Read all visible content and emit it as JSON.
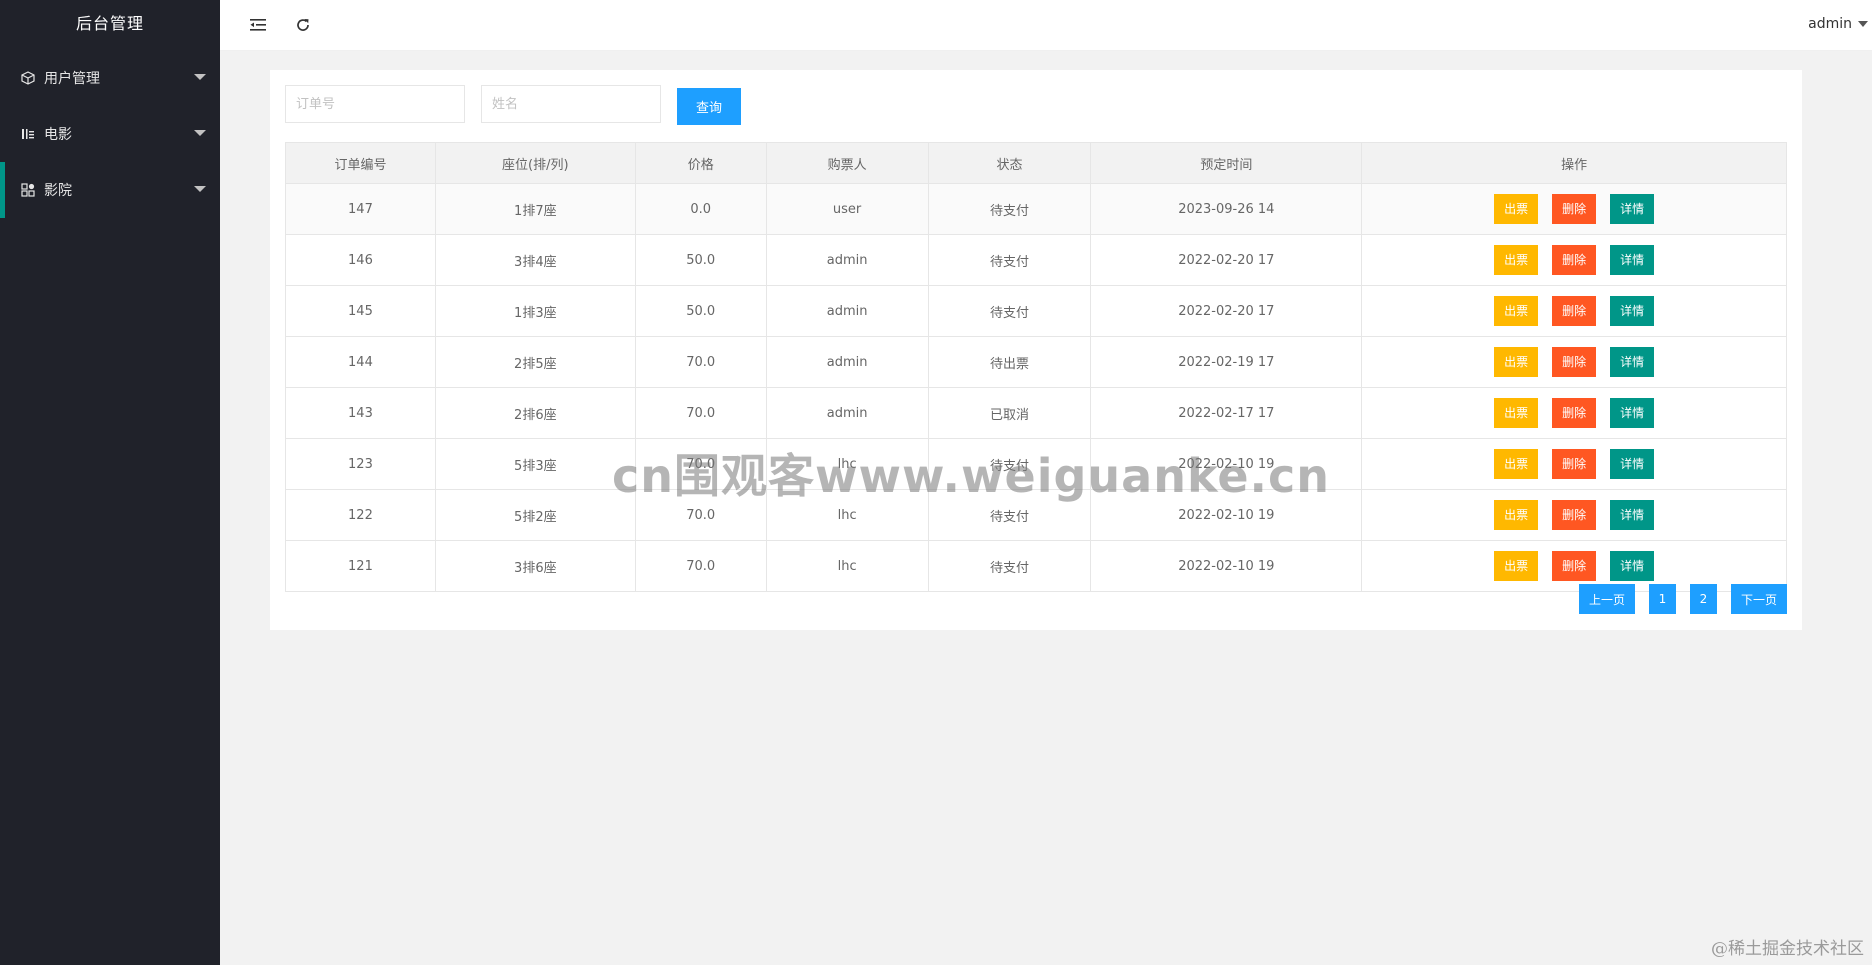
{
  "sidebar": {
    "title": "后台管理",
    "items": [
      {
        "label": "用户管理",
        "icon": "cube-icon"
      },
      {
        "label": "电影",
        "icon": "film-icon"
      },
      {
        "label": "影院",
        "icon": "apps-icon"
      }
    ],
    "accent": "#009688"
  },
  "header": {
    "user": "admin"
  },
  "search": {
    "order_placeholder": "订单号",
    "name_placeholder": "姓名",
    "query_label": "查询"
  },
  "table": {
    "columns": [
      "订单编号",
      "座位(排/列)",
      "价格",
      "购票人",
      "状态",
      "预定时间",
      "操作"
    ],
    "rows": [
      {
        "id": "147",
        "seat": "1排7座",
        "price": "0.0",
        "buyer": "user",
        "status": "待支付",
        "time": "2023-09-26 14"
      },
      {
        "id": "146",
        "seat": "3排4座",
        "price": "50.0",
        "buyer": "admin",
        "status": "待支付",
        "time": "2022-02-20 17"
      },
      {
        "id": "145",
        "seat": "1排3座",
        "price": "50.0",
        "buyer": "admin",
        "status": "待支付",
        "time": "2022-02-20 17"
      },
      {
        "id": "144",
        "seat": "2排5座",
        "price": "70.0",
        "buyer": "admin",
        "status": "待出票",
        "time": "2022-02-19 17"
      },
      {
        "id": "143",
        "seat": "2排6座",
        "price": "70.0",
        "buyer": "admin",
        "status": "已取消",
        "time": "2022-02-17 17"
      },
      {
        "id": "123",
        "seat": "5排3座",
        "price": "70.0",
        "buyer": "lhc",
        "status": "待支付",
        "time": "2022-02-10 19"
      },
      {
        "id": "122",
        "seat": "5排2座",
        "price": "70.0",
        "buyer": "lhc",
        "status": "待支付",
        "time": "2022-02-10 19"
      },
      {
        "id": "121",
        "seat": "3排6座",
        "price": "70.0",
        "buyer": "lhc",
        "status": "待支付",
        "time": "2022-02-10 19"
      }
    ],
    "actions": [
      {
        "label": "出票",
        "color": "#ffb800",
        "name": "issue-ticket-button"
      },
      {
        "label": "删除",
        "color": "#ff5722",
        "name": "delete-button"
      },
      {
        "label": "详情",
        "color": "#009688",
        "name": "details-button"
      }
    ]
  },
  "pager": {
    "prev": "上一页",
    "pages": [
      "1",
      "2"
    ],
    "next": "下一页"
  },
  "watermark": "cn围观客www.weiguanke.cn",
  "credit": "@稀土掘金技术社区"
}
